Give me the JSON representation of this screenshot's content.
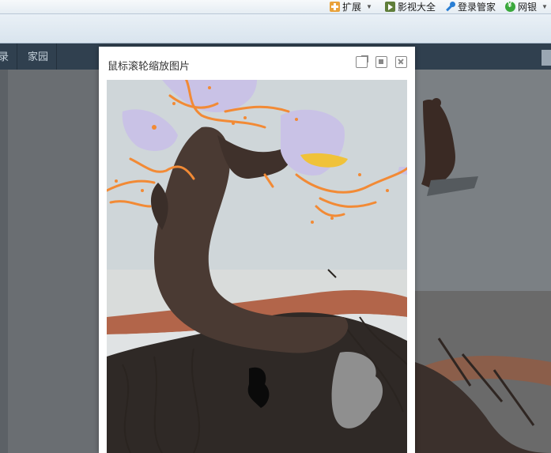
{
  "toolbar": {
    "items": [
      {
        "label": "扩展",
        "icon": "extension-icon"
      },
      {
        "label": "影视大全",
        "icon": "video-icon"
      },
      {
        "label": "登录管家",
        "icon": "key-icon"
      },
      {
        "label": "网银",
        "icon": "bank-icon"
      }
    ]
  },
  "nav": {
    "partial_item": "录",
    "item": "家园"
  },
  "dialog": {
    "title": "鼠标滚轮缩放图片"
  }
}
